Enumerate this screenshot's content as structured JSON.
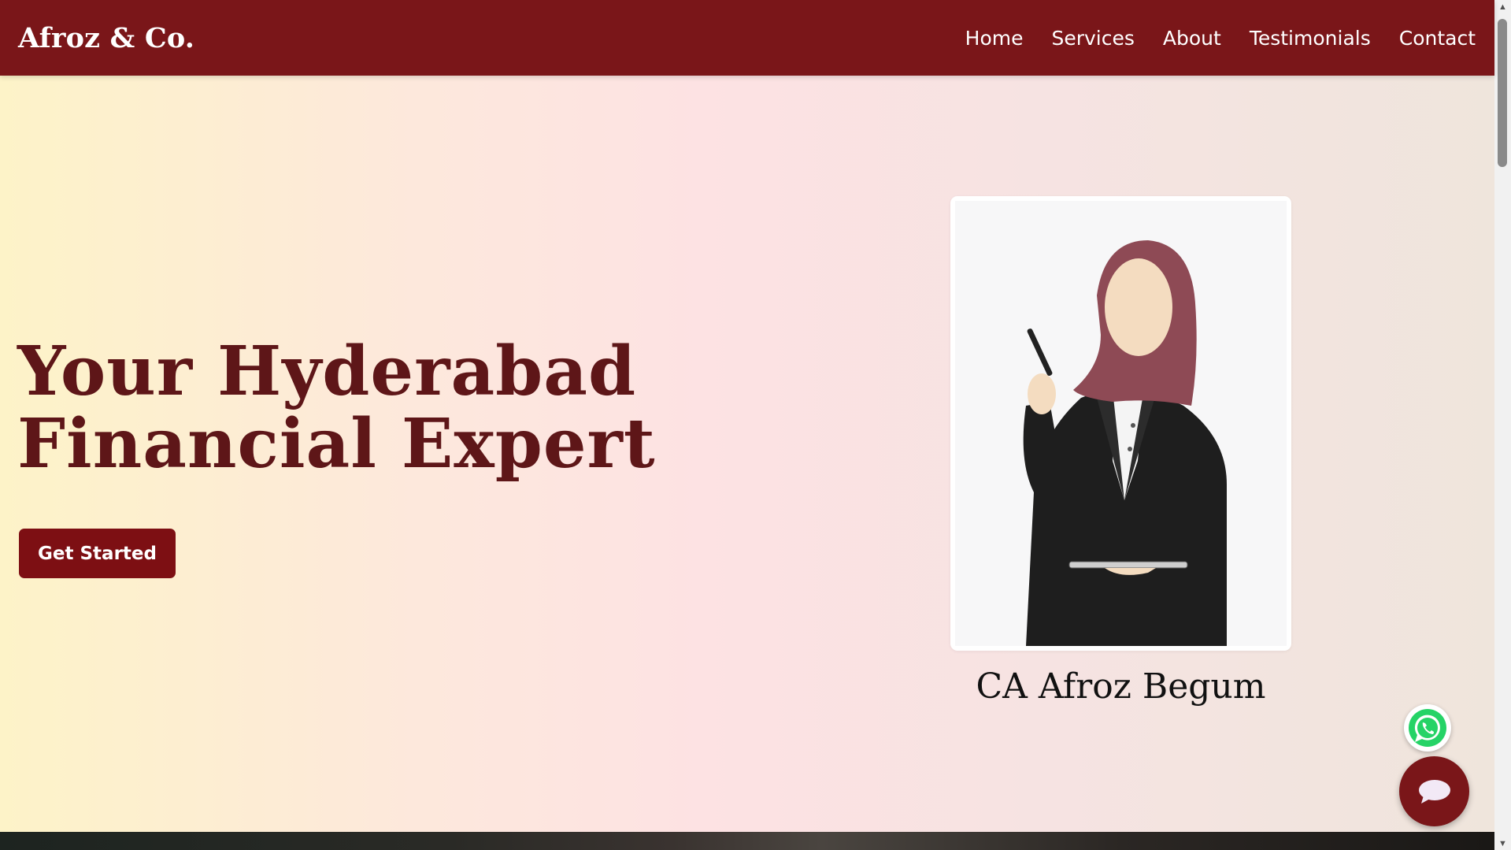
{
  "header": {
    "brand": "Afroz & Co.",
    "nav": [
      {
        "label": "Home"
      },
      {
        "label": "Services"
      },
      {
        "label": "About"
      },
      {
        "label": "Testimonials"
      },
      {
        "label": "Contact"
      }
    ]
  },
  "hero": {
    "title_line1": "Your Hyderabad",
    "title_line2": "Financial Expert",
    "cta_label": "Get Started",
    "person_name": "CA Afroz Begum",
    "portrait_alt": "Illustration of woman in hijab and black blazer holding a pen and tablet"
  },
  "floating": {
    "whatsapp_icon": "whatsapp-icon",
    "chat_icon": "chat-bubble-icon"
  },
  "colors": {
    "primary": "#7a1619",
    "button": "#7d0f13",
    "title": "#5e1618",
    "whatsapp": "#25d366"
  }
}
